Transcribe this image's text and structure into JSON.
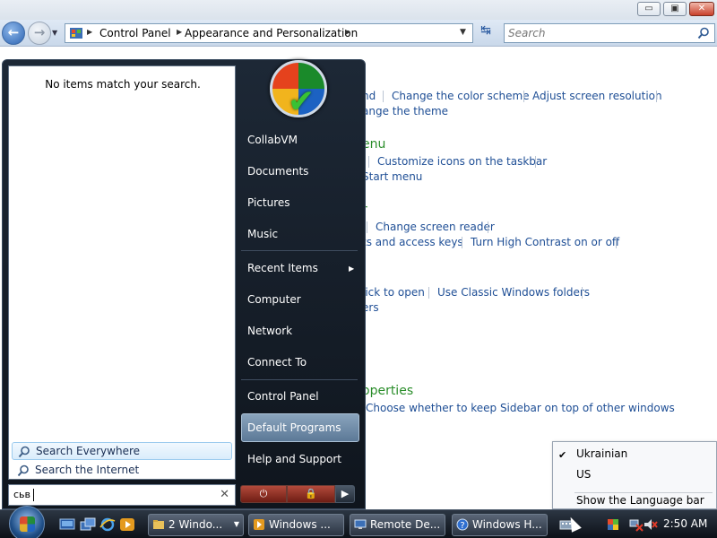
{
  "window": {
    "controls": {
      "minimize": "▭",
      "maximize": "▣",
      "close": "✕"
    },
    "nav": {
      "back": "←",
      "forward": "→",
      "history": "▼"
    },
    "breadcrumbs": [
      "Control Panel",
      "Appearance and Personalization"
    ],
    "address_dropdown": "▼",
    "refresh": "↹",
    "search_placeholder": "Search"
  },
  "content": {
    "links": {
      "color_fragment": "nd",
      "change_color_scheme": "Change the color scheme",
      "adjust_resolution": "Adjust screen resolution",
      "change_theme": "ange the theme",
      "menu_heading": "enu",
      "customize_taskbar": "Customize icons on the taskbar",
      "start_menu": "Start menu",
      "ease_heading": "r",
      "change_reader": "Change screen reader",
      "shortcuts": "ts and access keys",
      "high_contrast": "Turn High Contrast on or off",
      "click_open": "lick to open",
      "classic_folders": "Use Classic Windows folders",
      "folders_frag": "ers",
      "properties_heading": "operties",
      "sidebar_top": "Choose whether to keep Sidebar on top of other windows"
    }
  },
  "start_menu": {
    "no_items": "No items match your search.",
    "search_everywhere": "Search Everywhere",
    "search_internet": "Search the Internet",
    "search_query": "сьв",
    "clear": "✕",
    "right_items": {
      "user": "CollabVM",
      "documents": "Documents",
      "pictures": "Pictures",
      "music": "Music",
      "recent": "Recent Items",
      "computer": "Computer",
      "network": "Network",
      "connect": "Connect To",
      "control_panel": "Control Panel",
      "default_programs": "Default Programs",
      "help": "Help and Support"
    },
    "submenu_arrow": "▶",
    "power": {
      "power_symbol": "⏻",
      "lock_symbol": "🔒",
      "arrow": "▶"
    }
  },
  "language_menu": {
    "check": "✔",
    "items": [
      "Ukrainian",
      "US"
    ],
    "show_bar": "Show the Language bar"
  },
  "taskbar": {
    "tasks": [
      "2 Windo...",
      "Windows ...",
      "Remote De...",
      "Windows H..."
    ],
    "group_arrow": "▼",
    "clock": "2:50 AM"
  }
}
